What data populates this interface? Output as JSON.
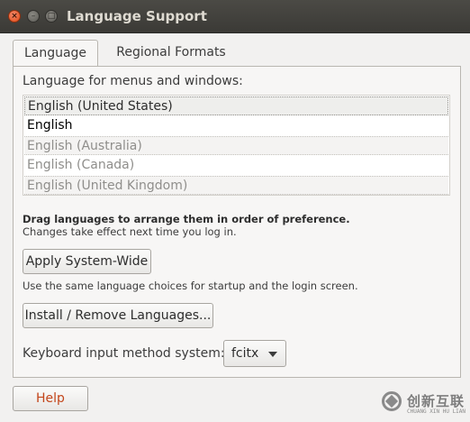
{
  "window": {
    "title": "Language Support",
    "controls": {
      "close": "×",
      "minimize": "–",
      "maximize": "□"
    }
  },
  "tabs": [
    {
      "label": "Language",
      "active": true
    },
    {
      "label": "Regional Formats",
      "active": false
    }
  ],
  "language_tab": {
    "section_label": "Language for menus and windows:",
    "languages": [
      {
        "name": "English (United States)",
        "state": "selected"
      },
      {
        "name": "English",
        "state": "enabled"
      },
      {
        "name": "English (Australia)",
        "state": "disabled"
      },
      {
        "name": "English (Canada)",
        "state": "disabled"
      },
      {
        "name": "English (United Kingdom)",
        "state": "disabled"
      }
    ],
    "hint_bold": "Drag languages to arrange them in order of preference.",
    "hint": "Changes take effect next time you log in.",
    "apply_button": "Apply System-Wide",
    "apply_description": "Use the same language choices for startup and the login screen.",
    "install_button": "Install / Remove Languages...",
    "keyboard_label": "Keyboard input method system:",
    "keyboard_value": "fcitx"
  },
  "footer": {
    "help_button": "Help"
  },
  "watermark": {
    "text": "创新互联",
    "subtext": "CHUANG XIN HU LIAN"
  },
  "colors": {
    "titlebar": "#3c3b37",
    "window_bg": "#f2f1f0",
    "close_button": "#df4b16",
    "help_text": "#c3461b",
    "disabled_text": "#8f8e8b"
  }
}
